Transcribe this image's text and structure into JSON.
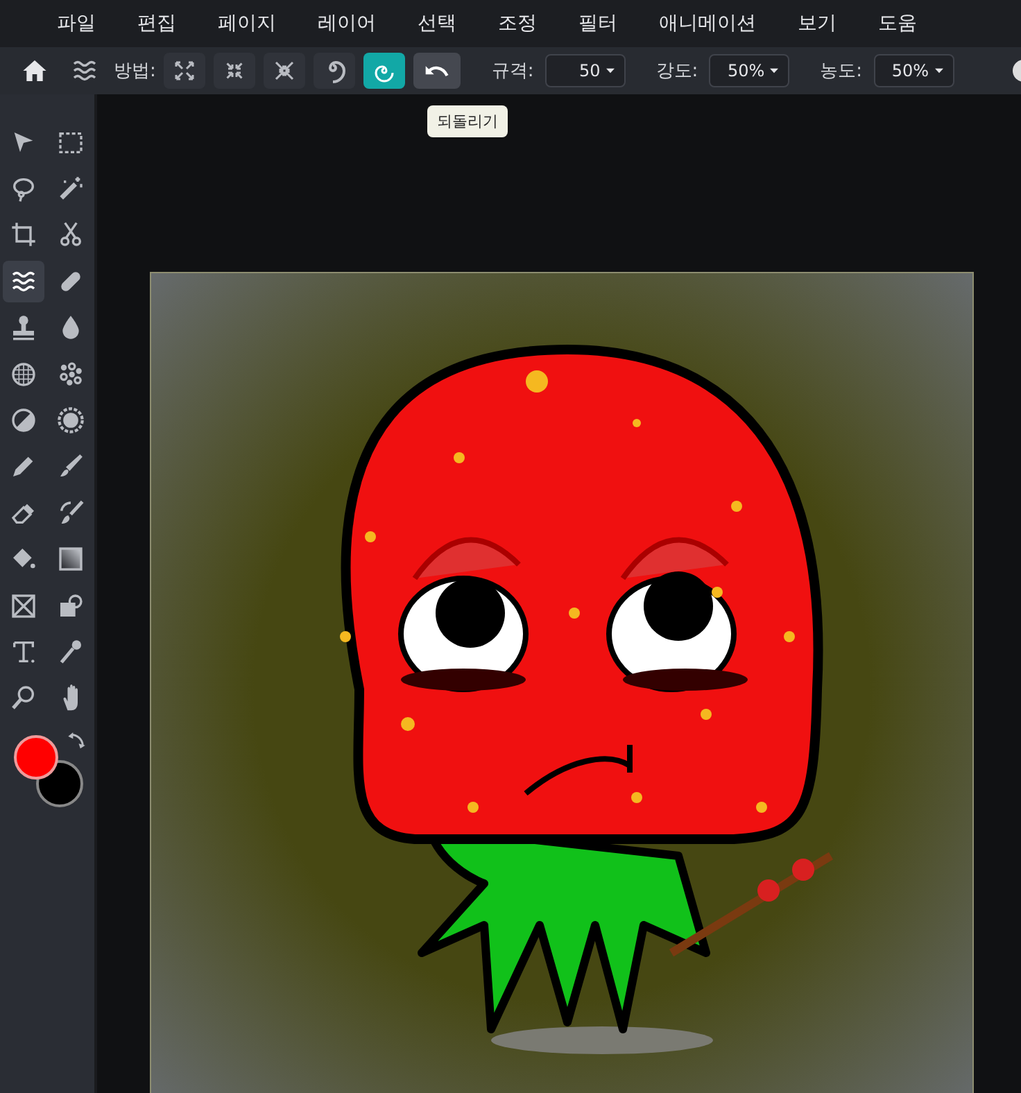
{
  "menu": [
    "파일",
    "편집",
    "페이지",
    "레이어",
    "선택",
    "조정",
    "필터",
    "애니메이션",
    "보기",
    "도움"
  ],
  "toolbar": {
    "method_label": "방법:",
    "methods": [
      {
        "kind": "expand",
        "selected": false
      },
      {
        "kind": "pinch",
        "selected": false
      },
      {
        "kind": "shrink",
        "selected": false
      },
      {
        "kind": "swirl",
        "selected": false
      },
      {
        "kind": "swirl-reverse",
        "selected": true
      }
    ],
    "undo_tooltip": "되돌리기",
    "fields": [
      {
        "label": "규격:",
        "value": "50"
      },
      {
        "label": "강도:",
        "value": "50%"
      },
      {
        "label": "농도:",
        "value": "50%"
      }
    ]
  },
  "tools": [
    {
      "kind": "pointer",
      "selected": false
    },
    {
      "kind": "marquee",
      "selected": false
    },
    {
      "kind": "lasso",
      "selected": false
    },
    {
      "kind": "wand",
      "selected": false
    },
    {
      "kind": "crop",
      "selected": false
    },
    {
      "kind": "scissors",
      "selected": false
    },
    {
      "kind": "liquify",
      "selected": true
    },
    {
      "kind": "bandage",
      "selected": false
    },
    {
      "kind": "stamp",
      "selected": false
    },
    {
      "kind": "drop",
      "selected": false
    },
    {
      "kind": "grid",
      "selected": false
    },
    {
      "kind": "dots",
      "selected": false
    },
    {
      "kind": "contrast",
      "selected": false
    },
    {
      "kind": "sponge",
      "selected": false
    },
    {
      "kind": "pen",
      "selected": false
    },
    {
      "kind": "brush",
      "selected": false
    },
    {
      "kind": "eraser",
      "selected": false
    },
    {
      "kind": "recolor",
      "selected": false
    },
    {
      "kind": "bucket",
      "selected": false
    },
    {
      "kind": "gradient",
      "selected": false
    },
    {
      "kind": "frame",
      "selected": false
    },
    {
      "kind": "shape",
      "selected": false
    },
    {
      "kind": "text",
      "selected": false
    },
    {
      "kind": "eyedropper",
      "selected": false
    },
    {
      "kind": "zoom",
      "selected": false
    },
    {
      "kind": "hand",
      "selected": false
    }
  ],
  "swatches": [
    {
      "kind": "background",
      "color": "#000000"
    },
    {
      "kind": "foreground",
      "color": "#ff0000"
    }
  ]
}
